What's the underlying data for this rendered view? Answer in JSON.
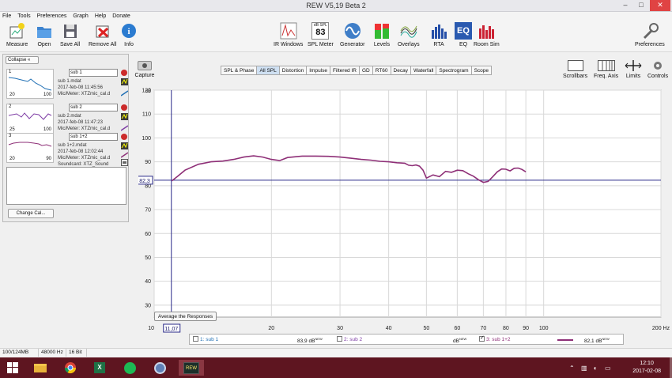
{
  "window": {
    "title": "REW V5,19 Beta 2",
    "min": "–",
    "max": "□",
    "close": "✕"
  },
  "menu": [
    "File",
    "Tools",
    "Preferences",
    "Graph",
    "Help",
    "Donate"
  ],
  "toolbar": {
    "measure": "Measure",
    "open": "Open",
    "save_all": "Save All",
    "remove_all": "Remove All",
    "info": "Info",
    "ir_windows": "IR Windows",
    "spl_meter": "SPL Meter",
    "spl_meter_unit": "dB SPL",
    "spl_meter_value": "83",
    "generator": "Generator",
    "levels": "Levels",
    "overlays": "Overlays",
    "rta": "RTA",
    "eq": "EQ",
    "room_sim": "Room Sim",
    "preferences": "Preferences"
  },
  "right_tools": {
    "scrollbars": "Scrollbars",
    "freq_axis": "Freq. Axis",
    "limits": "Limits",
    "controls": "Controls"
  },
  "panel": {
    "collapse": "Collapse",
    "measurements": [
      {
        "num": "1",
        "name": "sub 1",
        "file": "sub 1.mdat",
        "date": "2017-feb-08 11:45:56",
        "mic": "Mic/Meter: XTZmic_cal.d",
        "sound": "Soundcard: XTZ_Sound",
        "tmin": "20",
        "tmax": "100",
        "color": "#1f6fb4"
      },
      {
        "num": "2",
        "name": "sub 2",
        "file": "sub 2.mdat",
        "date": "2017-feb-08 11:47:23",
        "mic": "Mic/Meter: XTZmic_cal.d",
        "sound": "Soundcard: XTZ_Sound",
        "tmin": "25",
        "tmax": "100",
        "color": "#7d3ba4"
      },
      {
        "num": "3",
        "name": "sub 1+2",
        "file": "sub 1+2.mdat",
        "date": "2017-feb-08 12:02:44",
        "mic": "Mic/Meter: XTZmic_cal.d",
        "sound": "Soundcard: XTZ_Sound",
        "tmin": "20",
        "tmax": "90",
        "color": "#8e2f77"
      }
    ],
    "change_cal": "Change Cal..."
  },
  "capture": "Capture",
  "tabs": [
    "SPL & Phase",
    "All SPL",
    "Distortion",
    "Impulse",
    "Filtered IR",
    "GD",
    "RT60",
    "Decay",
    "Waterfall",
    "Spectrogram",
    "Scope"
  ],
  "active_tab": "All SPL",
  "average_button": "Average the Responses",
  "cursor": {
    "level": "82,3",
    "freq": "11,07"
  },
  "legend": [
    {
      "label": "1: sub 1",
      "value": "83,9 dB",
      "sup": "NEW",
      "checked": false
    },
    {
      "label": "2: sub 2",
      "value": "dB",
      "sup": "NEW",
      "checked": false
    },
    {
      "label": "3: sub 1+2",
      "value": "82,1 dB",
      "sup": "NEW",
      "checked": true
    }
  ],
  "chart_data": {
    "type": "line",
    "ylabel": "dB",
    "ylim": [
      25,
      120
    ],
    "xlim": [
      10,
      200
    ],
    "xscale": "log",
    "y_ticks": [
      120,
      110,
      100,
      90,
      80,
      70,
      60,
      50,
      40,
      30
    ],
    "x_ticks": [
      10,
      20,
      30,
      40,
      50,
      60,
      70,
      80,
      90,
      100,
      200
    ],
    "x_tick_labels": [
      "10",
      "20",
      "30",
      "40",
      "50",
      "60",
      "70",
      "80",
      "90",
      "100",
      "200 Hz"
    ],
    "cursor_x": 11.07,
    "cursor_y": 82.3,
    "series": [
      {
        "color": "#8e2f77",
        "x": [
          11.1,
          11.5,
          12,
          13,
          14,
          15,
          16,
          17,
          18,
          19,
          20,
          21,
          22,
          24,
          26,
          28,
          30,
          32,
          34,
          36,
          38,
          40,
          42,
          44,
          45,
          46,
          47,
          48,
          49,
          50,
          52,
          54,
          56,
          58,
          60,
          62,
          64,
          66,
          68,
          70,
          72,
          74,
          76,
          78,
          80,
          82,
          84,
          86,
          88,
          90
        ],
        "y": [
          82,
          84,
          86.5,
          89,
          90,
          90.3,
          91,
          92,
          92.5,
          92,
          91,
          90.5,
          91.8,
          92.4,
          92.4,
          92.3,
          92,
          91.5,
          91,
          90.7,
          90.2,
          90,
          89.6,
          89.4,
          88.6,
          88.4,
          88.7,
          88.2,
          86.5,
          83.2,
          84.5,
          83.8,
          86,
          85.6,
          86.5,
          86.3,
          85,
          84,
          82.5,
          81.4,
          81.8,
          83.8,
          85.8,
          87,
          86.9,
          86.2,
          87.3,
          87.4,
          86.8,
          85.8
        ]
      }
    ]
  },
  "status": {
    "memory": "100/124MB",
    "rate": "48000 Hz",
    "bits": "16 Bit"
  },
  "clock": {
    "time": "12:10",
    "date": "2017-02-08"
  }
}
